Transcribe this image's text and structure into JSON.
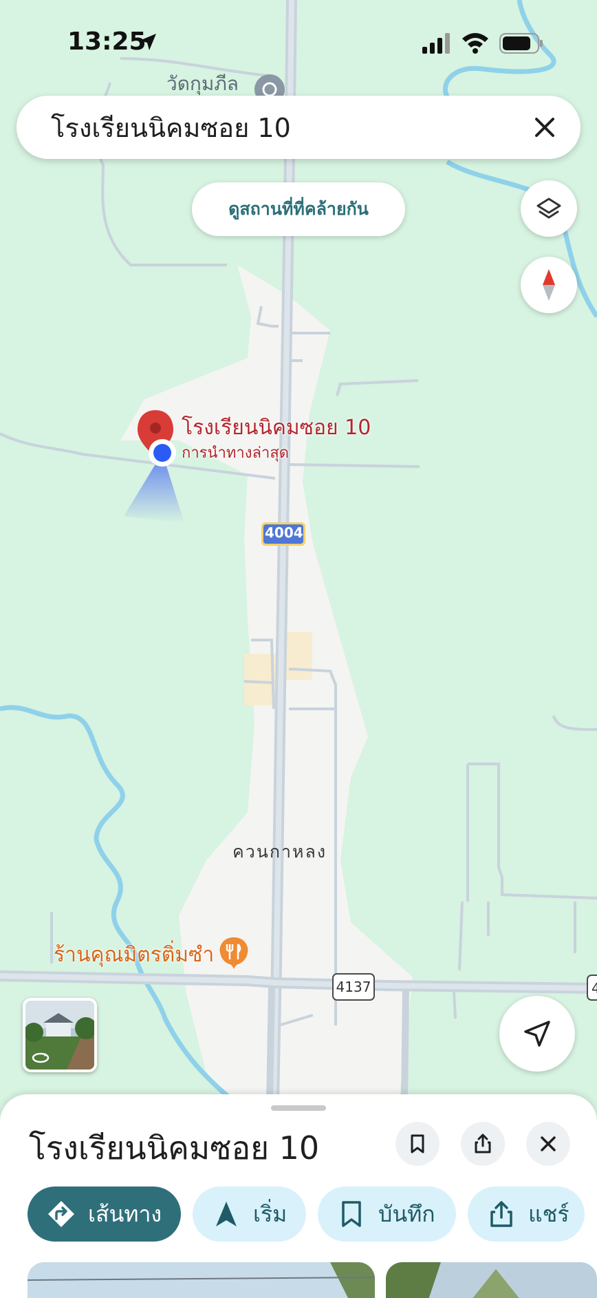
{
  "status_bar": {
    "time": "13:25"
  },
  "search": {
    "query": "โรงเรียนนิคมซอย 10"
  },
  "similar_places_button": "ดูสถานที่ที่คล้ายกัน",
  "map": {
    "labels": {
      "temple": "วัดกุมภีล",
      "place_name": "โรงเรียนนิคมซอย 10",
      "place_subtitle": "การนำทางล่าสุด",
      "area": "ควนกาหลง",
      "restaurant": "ร้านคุณมิตรติ่มซำ",
      "route_4004": "4004",
      "route_4137": "4137",
      "route_edge": "4"
    }
  },
  "sheet": {
    "title": "โรงเรียนนิคมซอย 10",
    "chips": {
      "directions": "เส้นทาง",
      "start": "เริ่ม",
      "save": "บันทึก",
      "share": "แชร์"
    }
  },
  "colors": {
    "map_green": "#d7f3e1",
    "road_white": "#f2f2f2",
    "road_gray": "#c8d3dc",
    "water": "#8fd1ea",
    "accent_teal": "#2f6f7a",
    "chip_blue": "#d9f1fb",
    "pin_red": "#d93b36",
    "location_blue": "#2a5cf5"
  }
}
